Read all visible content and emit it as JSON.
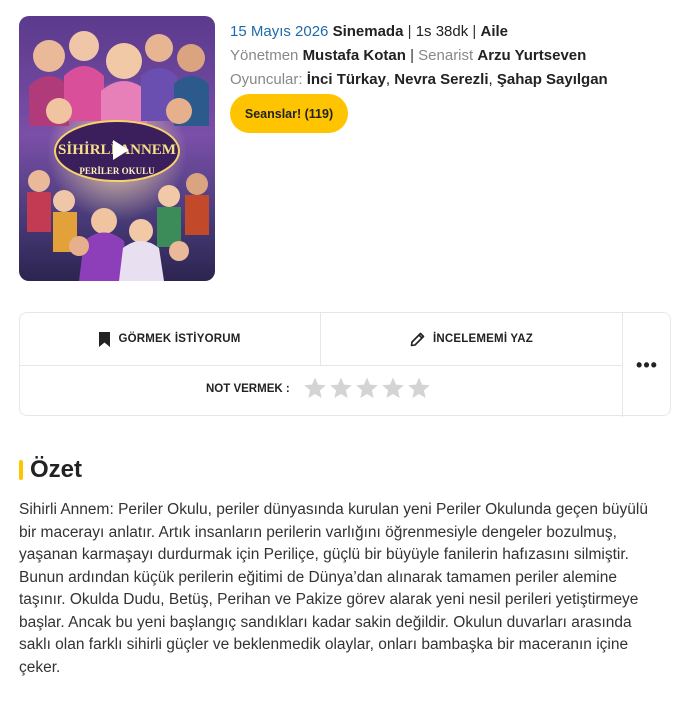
{
  "movie": {
    "date": "15 Mayıs 2026",
    "status": "Sinemada",
    "duration": "1s 38dk",
    "genre": "Aile",
    "director_label": "Yönetmen",
    "director": "Mustafa Kotan",
    "writer_label": "Senarist",
    "writer": "Arzu Yurtseven",
    "cast_label": "Oyuncular:",
    "cast": [
      "İnci Türkay",
      "Nevra Serezli",
      "Şahap Sayılgan"
    ],
    "separator": "|",
    "comma": ","
  },
  "poster": {
    "title_line1": "SİHİRLİ ANNEM",
    "title_line2": "PERİLER OKULU"
  },
  "buttons": {
    "showtimes": "Seanslar! (119)"
  },
  "actions": {
    "watchlist": "GÖRMEK İSTİYORUM",
    "review": "İNCELEMEMİ YAZ",
    "more": "•••",
    "rate_label": "NOT VERMEK :",
    "star_count": 5,
    "star_color": "#d4d4d4"
  },
  "summary": {
    "title": "Özet",
    "text": "Sihirli Annem: Periler Okulu, periler dünyasında kurulan yeni Periler Okulunda geçen büyülü bir macerayı anlatır. Artık insanların perilerin varlığını öğrenmesiyle dengeler bozulmuş, yaşanan karmaşayı durdurmak için Periliçe, güçlü bir büyüyle fanilerin hafızasını silmiştir. Bunun ardından küçük perilerin eğitimi de Dünya’dan alınarak tamamen periler alemine taşınır. Okulda Dudu, Betüş, Perihan ve Pakize görev alarak yeni nesil perileri yetiştirmeye başlar. Ancak bu yeni başlangıç sandıkları kadar sakin değildir. Okulun duvarları arasında saklı olan farklı sihirli güçler ve beklenmedik olaylar, onları bambaşka bir maceranın içine çeker."
  },
  "colors": {
    "accent": "#ffc400",
    "date_blue": "#1f6aa8"
  }
}
